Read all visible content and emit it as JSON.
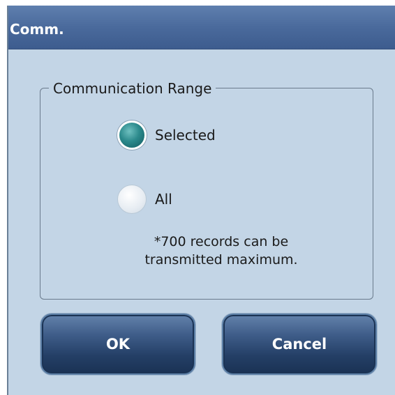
{
  "dialog": {
    "title": "Comm."
  },
  "range_group": {
    "legend": "Communication Range",
    "options": [
      {
        "label": "Selected",
        "checked": true
      },
      {
        "label": "All",
        "checked": false
      }
    ],
    "note_line1": "*700 records can be",
    "note_line2": "transmitted maximum."
  },
  "buttons": {
    "ok_label": "OK",
    "cancel_label": "Cancel"
  },
  "colors": {
    "window_bg": "#c3d5e6",
    "titlebar": "#4a6a9c",
    "button": "#2e4c78",
    "radio_selected": "#2c8a8c"
  }
}
